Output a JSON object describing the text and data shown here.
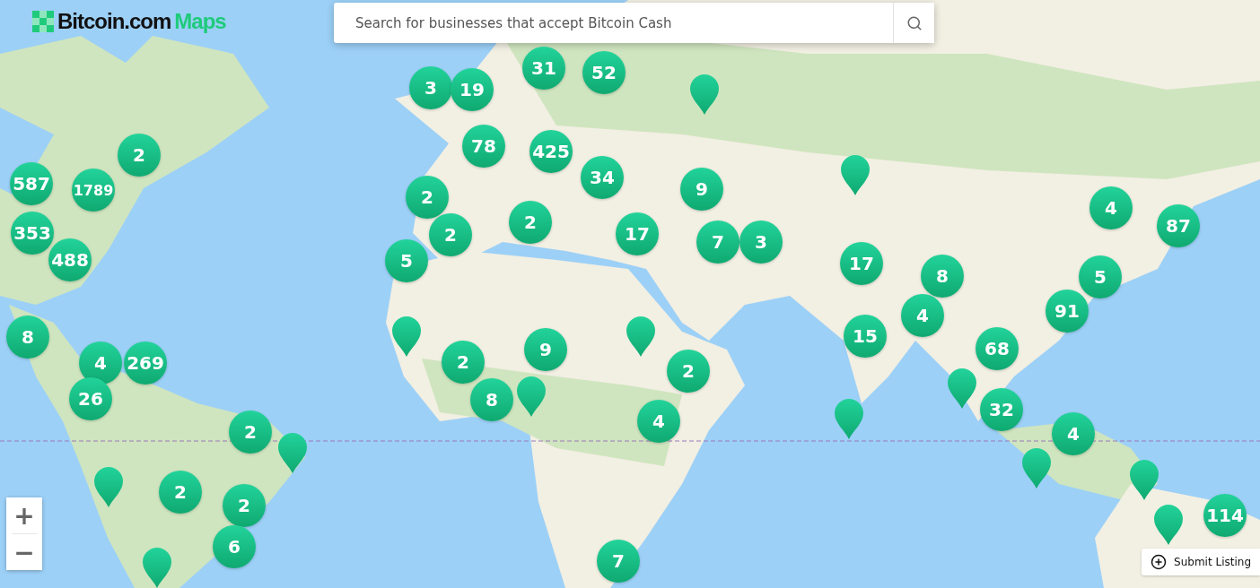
{
  "logo": {
    "brand": "Bitcoin.com",
    "product": "Maps"
  },
  "search": {
    "placeholder": "Search for businesses that accept Bitcoin Cash"
  },
  "markers": [
    {
      "kind": "cluster",
      "count": "3"
    },
    {
      "kind": "cluster",
      "count": "19"
    },
    {
      "kind": "cluster",
      "count": "31"
    },
    {
      "kind": "cluster",
      "count": "52"
    },
    {
      "kind": "pin"
    },
    {
      "kind": "cluster",
      "count": "2"
    },
    {
      "kind": "cluster",
      "count": "78"
    },
    {
      "kind": "cluster",
      "count": "425"
    },
    {
      "kind": "cluster",
      "count": "587"
    },
    {
      "kind": "cluster",
      "count": "1789"
    },
    {
      "kind": "cluster",
      "count": "2"
    },
    {
      "kind": "cluster",
      "count": "34"
    },
    {
      "kind": "cluster",
      "count": "9"
    },
    {
      "kind": "pin"
    },
    {
      "kind": "cluster",
      "count": "4"
    },
    {
      "kind": "cluster",
      "count": "353"
    },
    {
      "kind": "cluster",
      "count": "488"
    },
    {
      "kind": "cluster",
      "count": "5"
    },
    {
      "kind": "cluster",
      "count": "2"
    },
    {
      "kind": "cluster",
      "count": "2"
    },
    {
      "kind": "cluster",
      "count": "17"
    },
    {
      "kind": "cluster",
      "count": "7"
    },
    {
      "kind": "cluster",
      "count": "3"
    },
    {
      "kind": "cluster",
      "count": "17"
    },
    {
      "kind": "cluster",
      "count": "87"
    },
    {
      "kind": "cluster",
      "count": "8"
    },
    {
      "kind": "cluster",
      "count": "5"
    },
    {
      "kind": "cluster",
      "count": "4"
    },
    {
      "kind": "cluster",
      "count": "91"
    },
    {
      "kind": "cluster",
      "count": "8"
    },
    {
      "kind": "cluster",
      "count": "4"
    },
    {
      "kind": "cluster",
      "count": "269"
    },
    {
      "kind": "pin"
    },
    {
      "kind": "cluster",
      "count": "2"
    },
    {
      "kind": "cluster",
      "count": "9"
    },
    {
      "kind": "pin"
    },
    {
      "kind": "cluster",
      "count": "2"
    },
    {
      "kind": "cluster",
      "count": "15"
    },
    {
      "kind": "cluster",
      "count": "68"
    },
    {
      "kind": "cluster",
      "count": "26"
    },
    {
      "kind": "cluster",
      "count": "8"
    },
    {
      "kind": "pin"
    },
    {
      "kind": "cluster",
      "count": "4"
    },
    {
      "kind": "pin"
    },
    {
      "kind": "pin"
    },
    {
      "kind": "cluster",
      "count": "32"
    },
    {
      "kind": "cluster",
      "count": "2"
    },
    {
      "kind": "pin"
    },
    {
      "kind": "pin"
    },
    {
      "kind": "cluster",
      "count": "4"
    },
    {
      "kind": "pin"
    },
    {
      "kind": "pin"
    },
    {
      "kind": "cluster",
      "count": "2"
    },
    {
      "kind": "cluster",
      "count": "2"
    },
    {
      "kind": "pin"
    },
    {
      "kind": "cluster",
      "count": "114"
    },
    {
      "kind": "pin"
    },
    {
      "kind": "cluster",
      "count": "6"
    },
    {
      "kind": "cluster",
      "count": "7"
    }
  ],
  "zoom_controls": {
    "zoom_in": "+",
    "zoom_out": "−"
  },
  "submit_button": {
    "label": "Submit Listing"
  }
}
